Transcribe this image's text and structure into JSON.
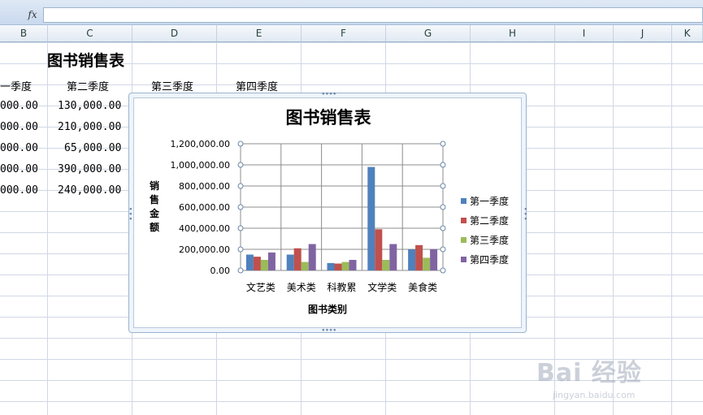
{
  "formula_bar": {
    "fx_label": "fx",
    "value": ""
  },
  "columns": [
    "B",
    "C",
    "D",
    "E",
    "F",
    "G",
    "H",
    "I",
    "J",
    "K"
  ],
  "sheet": {
    "title": "图书销售表",
    "headers": [
      "一季度",
      "第二季度",
      "第三季度",
      "第四季度"
    ],
    "col_b": [
      "000.00",
      "000.00",
      "000.00",
      "000.00",
      "000.00"
    ],
    "col_c": [
      "130,000.00",
      "210,000.00",
      "65,000.00",
      "390,000.00",
      "240,000.00"
    ]
  },
  "chart_data": {
    "type": "bar",
    "title": "图书销售表",
    "xlabel": "图书类别",
    "ylabel": "销售金额",
    "categories": [
      "文艺类",
      "美术类",
      "科教累",
      "文学类",
      "美食类"
    ],
    "ylim": [
      0,
      1200000
    ],
    "yticks": [
      "0.00",
      "200,000.00",
      "400,000.00",
      "600,000.00",
      "800,000.00",
      "1,000,000.00",
      "1,200,000.00"
    ],
    "grid": true,
    "legend_position": "right",
    "series": [
      {
        "name": "第一季度",
        "color": "#4f81bd",
        "values": [
          150000,
          150000,
          70000,
          980000,
          200000
        ]
      },
      {
        "name": "第二季度",
        "color": "#c0504d",
        "values": [
          130000,
          210000,
          65000,
          390000,
          240000
        ]
      },
      {
        "name": "第三季度",
        "color": "#9bbb59",
        "values": [
          100000,
          80000,
          80000,
          100000,
          120000
        ]
      },
      {
        "name": "第四季度",
        "color": "#8064a2",
        "values": [
          170000,
          250000,
          100000,
          250000,
          200000
        ]
      }
    ]
  },
  "watermark": {
    "main": "Bai 经验",
    "sub": "jingyan.baidu.com"
  }
}
